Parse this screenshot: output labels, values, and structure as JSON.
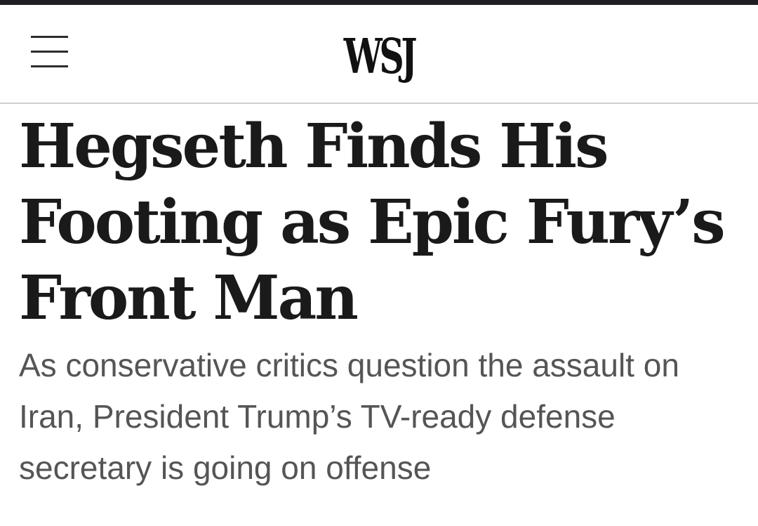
{
  "header": {
    "logo_text": "WSJ",
    "menu_icon": "hamburger-menu-icon"
  },
  "article": {
    "headline": "Hegseth Finds His Footing as Epic Fury’s Front Man",
    "headline_lines": [
      "Hegseth Finds His",
      "Footing as Epic Fury’s",
      "Front Man"
    ],
    "dek": "As conservative critics question the assault on Iran, President Trump’s TV-ready defense secretary is going on offense"
  },
  "colors": {
    "topbar": "#1f1f23",
    "headline": "#1a1a1a",
    "dek": "#555555",
    "divider": "#cfcfcf"
  }
}
